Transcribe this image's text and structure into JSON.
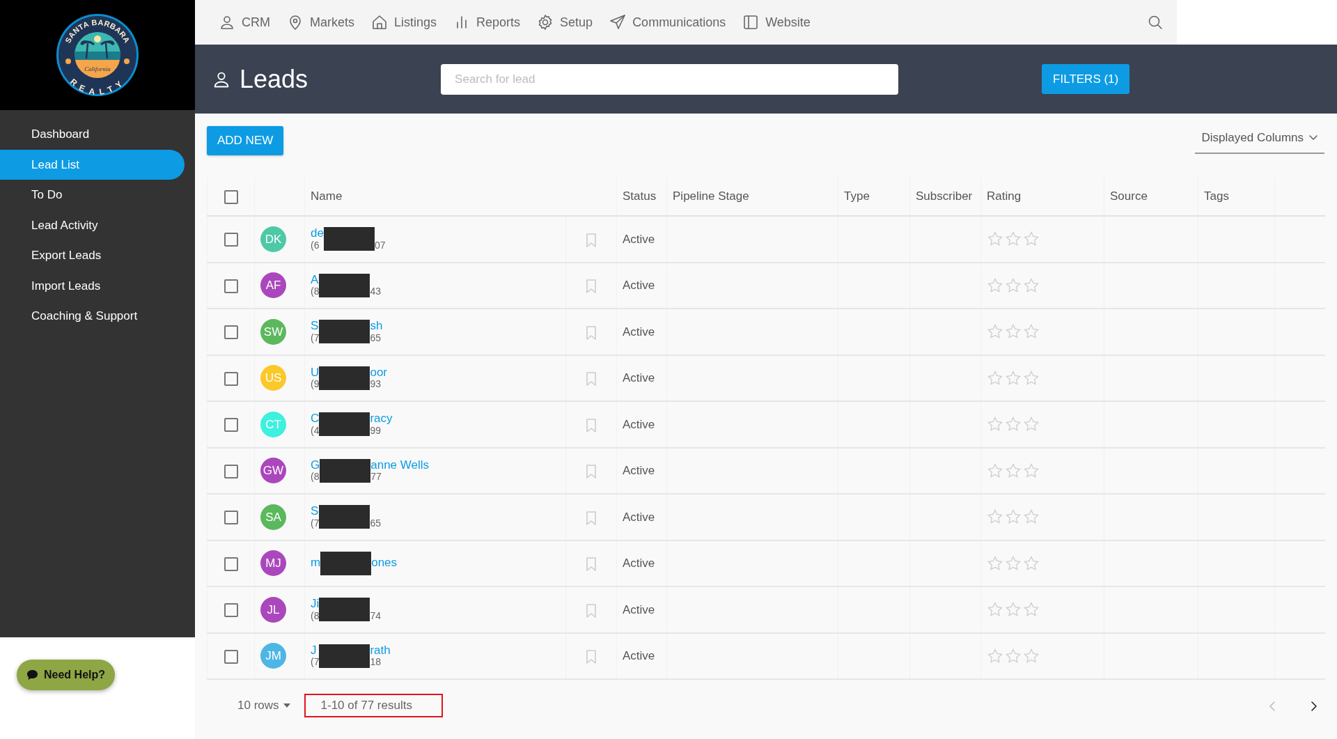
{
  "logo": {
    "top": "SANTA BARBARA",
    "middle": "California",
    "bottom": "REALTY"
  },
  "sidebar": {
    "items": [
      {
        "label": "Dashboard",
        "selected": false
      },
      {
        "label": "Lead List",
        "selected": true
      },
      {
        "label": "To Do",
        "selected": false
      },
      {
        "label": "Lead Activity",
        "selected": false
      },
      {
        "label": "Export Leads",
        "selected": false
      },
      {
        "label": "Import Leads",
        "selected": false
      },
      {
        "label": "Coaching & Support",
        "selected": false
      }
    ]
  },
  "top_nav": [
    {
      "label": "CRM"
    },
    {
      "label": "Markets"
    },
    {
      "label": "Listings"
    },
    {
      "label": "Reports"
    },
    {
      "label": "Setup"
    },
    {
      "label": "Communications"
    },
    {
      "label": "Website"
    }
  ],
  "page_title": "Leads",
  "search": {
    "placeholder": "Search for lead"
  },
  "filters_button": "FILTERS (1)",
  "add_button": "ADD NEW",
  "columns_menu": "Displayed Columns",
  "table": {
    "columns": [
      "Name",
      "Status",
      "Pipeline Stage",
      "Type",
      "Subscriber",
      "Rating",
      "Source",
      "Tags"
    ],
    "header_checked": false,
    "rows": [
      {
        "initials": "DK",
        "color": "#4dc9a6",
        "name_start": "de",
        "phone_parts": [
          "(6",
          "07"
        ],
        "status": "Active",
        "stars": 0,
        "checked": false
      },
      {
        "initials": "AF",
        "color": "#ab47bc",
        "name_start": "A",
        "phone_parts": [
          "(8",
          "43"
        ],
        "status": "Active",
        "stars": 0,
        "checked": false
      },
      {
        "initials": "SW",
        "color": "#5cb85c",
        "name_start": "S",
        "name_end": "sh",
        "phone_parts": [
          "(7",
          "65"
        ],
        "status": "Active",
        "stars": 0,
        "checked": false
      },
      {
        "initials": "US",
        "color": "#fbc82a",
        "name_start": "U",
        "name_end": "oor",
        "phone_parts": [
          "(9",
          "93"
        ],
        "status": "Active",
        "stars": 0,
        "checked": false
      },
      {
        "initials": "CT",
        "color": "#3ef0de",
        "name_start": "C",
        "name_end": "racy",
        "phone_parts": [
          "(4",
          "99"
        ],
        "status": "Active",
        "stars": 0,
        "checked": false
      },
      {
        "initials": "GW",
        "color": "#ab47bc",
        "name_start": "G",
        "name_end": "anne Wells",
        "phone_parts": [
          "(8",
          "77"
        ],
        "status": "Active",
        "stars": 0,
        "checked": false
      },
      {
        "initials": "SA",
        "color": "#5cb85c",
        "name_start": "S",
        "phone_parts": [
          "(7",
          "65"
        ],
        "status": "Active",
        "stars": 0,
        "checked": false
      },
      {
        "initials": "MJ",
        "color": "#ab47bc",
        "name_start": "m",
        "name_end": "ones",
        "status": "Active",
        "stars": 0,
        "checked": false
      },
      {
        "initials": "JL",
        "color": "#ab47bc",
        "name_start": "Ji",
        "phone_parts": [
          "(8",
          "74"
        ],
        "status": "Active",
        "stars": 0,
        "checked": false
      },
      {
        "initials": "JM",
        "color": "#4db6e4",
        "name_start": "J",
        "name_end": "rath",
        "phone_parts": [
          "(7",
          "18"
        ],
        "status": "Active",
        "stars": 0,
        "checked": false
      }
    ]
  },
  "footer": {
    "rows_per_page": "10 rows",
    "results": "1-10 of 77 results",
    "results_highlighted": true,
    "prev_disabled": true,
    "next_disabled": false
  },
  "help_button": "Need Help?"
}
